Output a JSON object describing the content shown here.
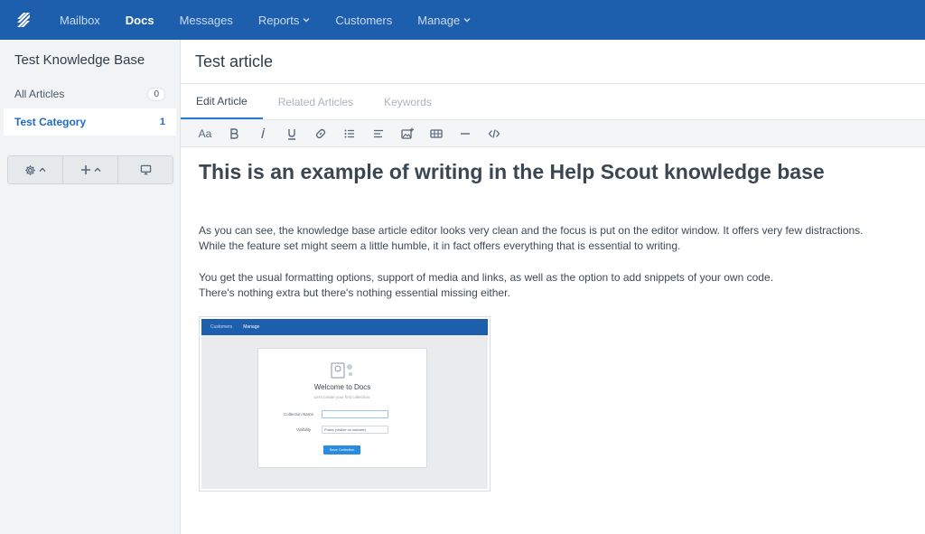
{
  "nav": {
    "items": [
      {
        "label": "Mailbox"
      },
      {
        "label": "Docs"
      },
      {
        "label": "Messages"
      },
      {
        "label": "Reports"
      },
      {
        "label": "Customers"
      },
      {
        "label": "Manage"
      }
    ],
    "active": "Docs",
    "color": "#1e5fad"
  },
  "sidebar": {
    "title": "Test Knowledge Base",
    "all_articles": {
      "label": "All Articles",
      "count": "0"
    },
    "category": {
      "label": "Test Category",
      "count": "1"
    },
    "tools": [
      "gear-icon",
      "plus-icon",
      "monitor-icon"
    ]
  },
  "article": {
    "title": "Test article",
    "tabs": [
      "Edit Article",
      "Related Articles",
      "Keywords"
    ],
    "active_tab": "Edit Article",
    "toolbar": {
      "font_label": "Aa"
    },
    "heading": "This is an example of writing in the Help Scout knowledge base",
    "para1_line1": "As you can see, the knowledge base article editor looks very clean and the focus is put on the editor window. It offers very few distractions.",
    "para1_line2": "While the feature set might seem a little humble, it in fact offers everything that is essential to writing.",
    "para2_line1": "You get the usual formatting options, support of media and links, as well as the option to add snippets of your own code.",
    "para2_line2": "There's nothing extra but there's nothing essential missing either."
  },
  "embedded_image": {
    "nav": [
      "Customers",
      "Manage"
    ],
    "title": "Welcome to Docs",
    "subtitle": "Let's create your first collection.",
    "collection_label": "Collection Name",
    "visibility_label": "Visibility",
    "visibility_value": "Public (visible on website)",
    "button": "Save Collection"
  }
}
